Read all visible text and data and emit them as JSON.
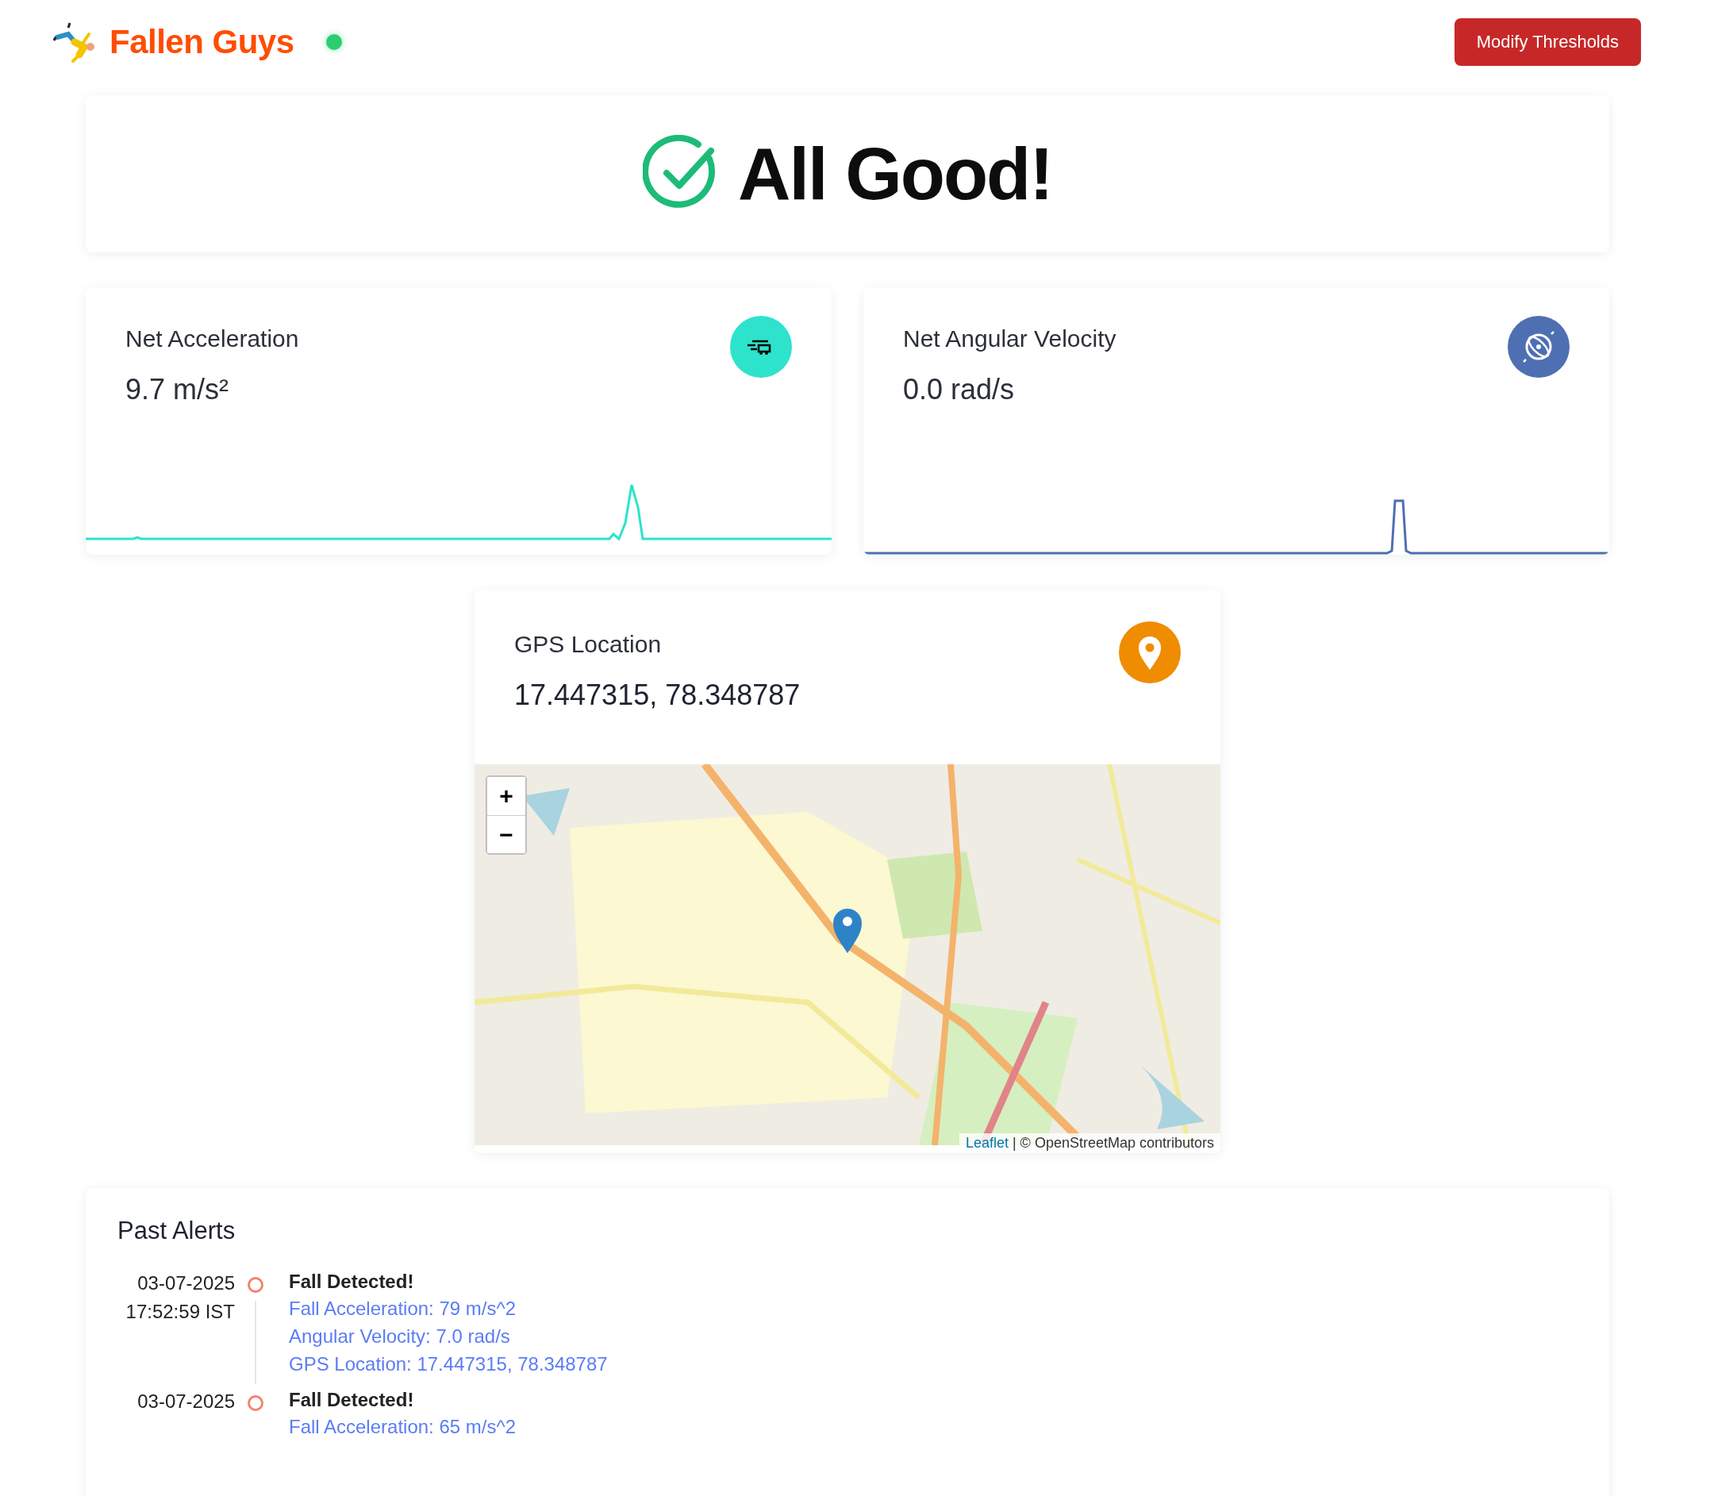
{
  "header": {
    "brand": "Fallen Guys",
    "online": true,
    "button": "Modify Thresholds"
  },
  "status": {
    "kind": "ok",
    "text": "All Good!"
  },
  "metrics": [
    {
      "kind": "acceleration",
      "title": "Net Acceleration",
      "value": "9.7 m/s²"
    },
    {
      "kind": "angular",
      "title": "Net Angular Velocity",
      "value": "0.0 rad/s"
    }
  ],
  "gps": {
    "title": "GPS Location",
    "value": "17.447315, 78.348787",
    "map": {
      "zoom_in": "+",
      "zoom_out": "−",
      "attribution_link": "Leaflet",
      "attribution": "| © OpenStreetMap contributors"
    }
  },
  "past_alerts": {
    "title": "Past Alerts",
    "alerts": [
      {
        "date": "03-07-2025",
        "time": "17:52:59 IST",
        "title": "Fall Detected!",
        "details": [
          "Fall Acceleration: 79 m/s^2",
          "Angular Velocity: 7.0 rad/s",
          "GPS Location: 17.447315, 78.348787"
        ]
      },
      {
        "date": "03-07-2025",
        "title": "Fall Detected!",
        "details": [
          "Fall Acceleration: 65 m/s^2"
        ]
      }
    ]
  }
}
